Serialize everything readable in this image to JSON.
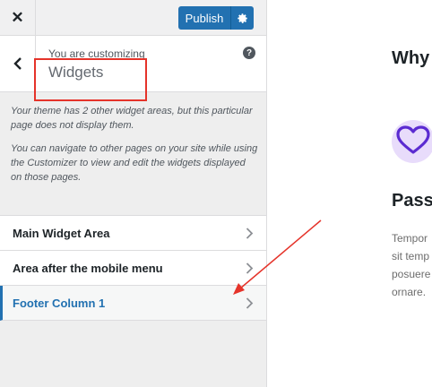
{
  "topbar": {
    "close_icon": "close-icon",
    "publish_label": "Publish",
    "gear_icon": "gear-icon"
  },
  "header": {
    "customizing_label": "You are customizing",
    "title": "Widgets",
    "help_label": "?"
  },
  "description": {
    "p1": "Your theme has 2 other widget areas, but this particular page does not display them.",
    "p2": "You can navigate to other pages on your site while using the Customizer to view and edit the widgets displayed on those pages."
  },
  "sections": [
    {
      "label": "Main Widget Area"
    },
    {
      "label": "Area after the mobile menu"
    },
    {
      "label": "Footer Column 1",
      "active": true
    }
  ],
  "preview": {
    "heading_1": "Why",
    "heading_2": "Passi",
    "text_lines": [
      "Tempor",
      "sit temp",
      "posuere",
      "ornare."
    ]
  },
  "colors": {
    "accent": "#2271b1",
    "annotation": "#e5332a",
    "heart": "#5b2bd1"
  }
}
